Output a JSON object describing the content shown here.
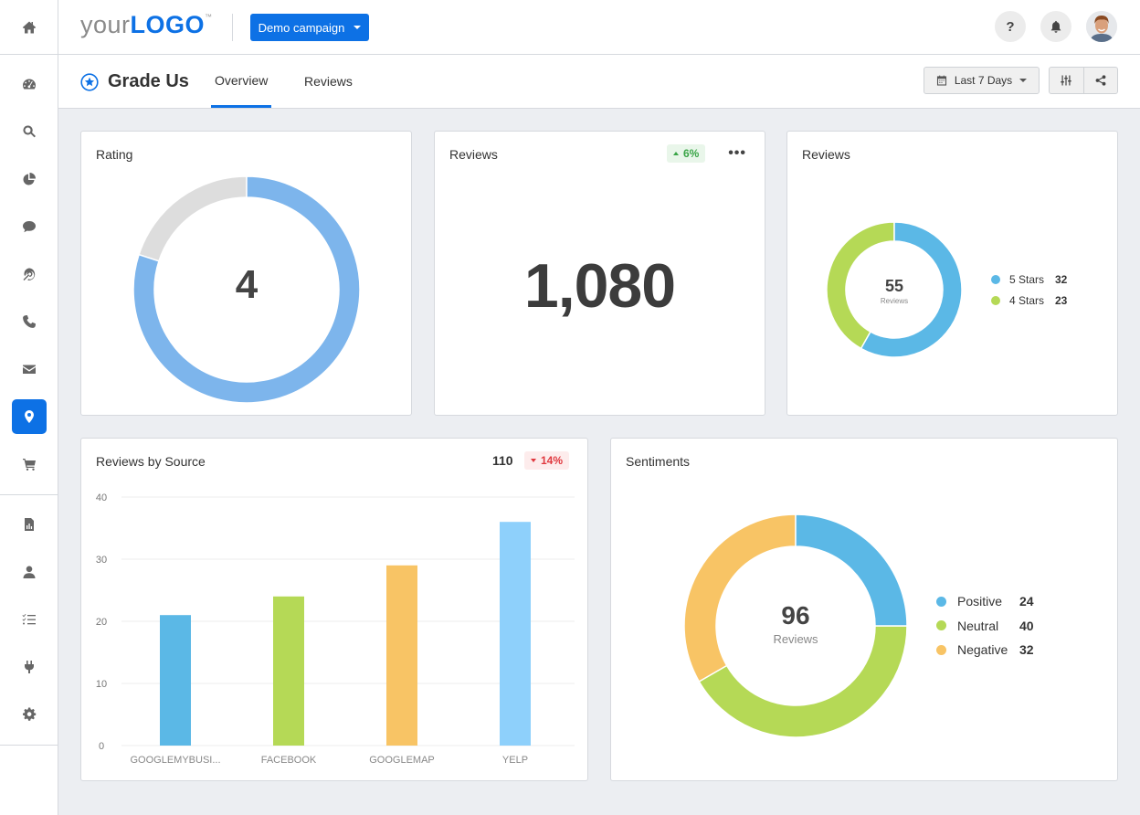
{
  "topbar": {
    "logo_your": "your",
    "logo_brand": "LOGO",
    "logo_tm": "™",
    "campaign_label": "Demo campaign",
    "help_label": "?",
    "icons": [
      "help-icon",
      "bell-icon",
      "user-avatar"
    ]
  },
  "sidebar": {
    "home_icon": "home-icon",
    "items": [
      {
        "icon": "dashboard-icon",
        "active": false
      },
      {
        "icon": "search-icon",
        "active": false
      },
      {
        "icon": "pie-chart-icon",
        "active": false
      },
      {
        "icon": "comment-icon",
        "active": false
      },
      {
        "icon": "target-icon",
        "active": false
      },
      {
        "icon": "phone-icon",
        "active": false
      },
      {
        "icon": "envelope-icon",
        "active": false
      },
      {
        "icon": "map-marker-icon",
        "active": true
      },
      {
        "icon": "cart-icon",
        "active": false
      }
    ],
    "items2": [
      {
        "icon": "report-icon"
      },
      {
        "icon": "user-icon"
      },
      {
        "icon": "task-list-icon"
      },
      {
        "icon": "plug-icon"
      },
      {
        "icon": "gear-icon"
      }
    ]
  },
  "subheader": {
    "title": "Grade Us",
    "tabs": [
      {
        "label": "Overview",
        "active": true
      },
      {
        "label": "Reviews",
        "active": false
      }
    ],
    "date_range": "Last 7 Days"
  },
  "accent_color": "#0d71e5",
  "cards": {
    "rating": {
      "title": "Rating",
      "value": "4",
      "max": 5
    },
    "reviews_total": {
      "title": "Reviews",
      "value": "1,080",
      "change": "6%",
      "change_direction": "up"
    },
    "reviews_stars": {
      "title": "Reviews",
      "center_value": "55",
      "center_label": "Reviews"
    },
    "reviews_by_source": {
      "title": "Reviews by Source",
      "total": "110",
      "change": "14%",
      "change_direction": "down"
    },
    "sentiments": {
      "title": "Sentiments",
      "center_value": "96",
      "center_label": "Reviews"
    }
  },
  "chart_data": [
    {
      "type": "pie",
      "title": "Rating",
      "labels": [
        "Rating",
        "Remaining"
      ],
      "values": [
        4,
        1
      ],
      "colors": [
        "#7db5ec",
        "#dddddd"
      ]
    },
    {
      "type": "pie",
      "title": "Reviews",
      "labels": [
        "5 Stars",
        "4 Stars"
      ],
      "values": [
        32,
        23
      ],
      "colors": [
        "#5bb8e6",
        "#b5d956"
      ],
      "legend": "right"
    },
    {
      "type": "bar",
      "title": "Reviews by Source",
      "categories": [
        "GOOGLEMYBUSI...",
        "FACEBOOK",
        "GOOGLEMAP",
        "YELP"
      ],
      "values": [
        21,
        24,
        29,
        36
      ],
      "colors": [
        "#5bb8e6",
        "#b5d956",
        "#f8c465",
        "#8ed0fb"
      ],
      "yticks": [
        0,
        10,
        20,
        30,
        40
      ],
      "ylim": [
        0,
        40
      ],
      "grid": true
    },
    {
      "type": "pie",
      "title": "Sentiments",
      "labels": [
        "Positive",
        "Neutral",
        "Negative"
      ],
      "values": [
        24,
        40,
        32
      ],
      "colors": [
        "#5bb8e6",
        "#b5d956",
        "#f8c465"
      ],
      "legend": "right"
    }
  ]
}
